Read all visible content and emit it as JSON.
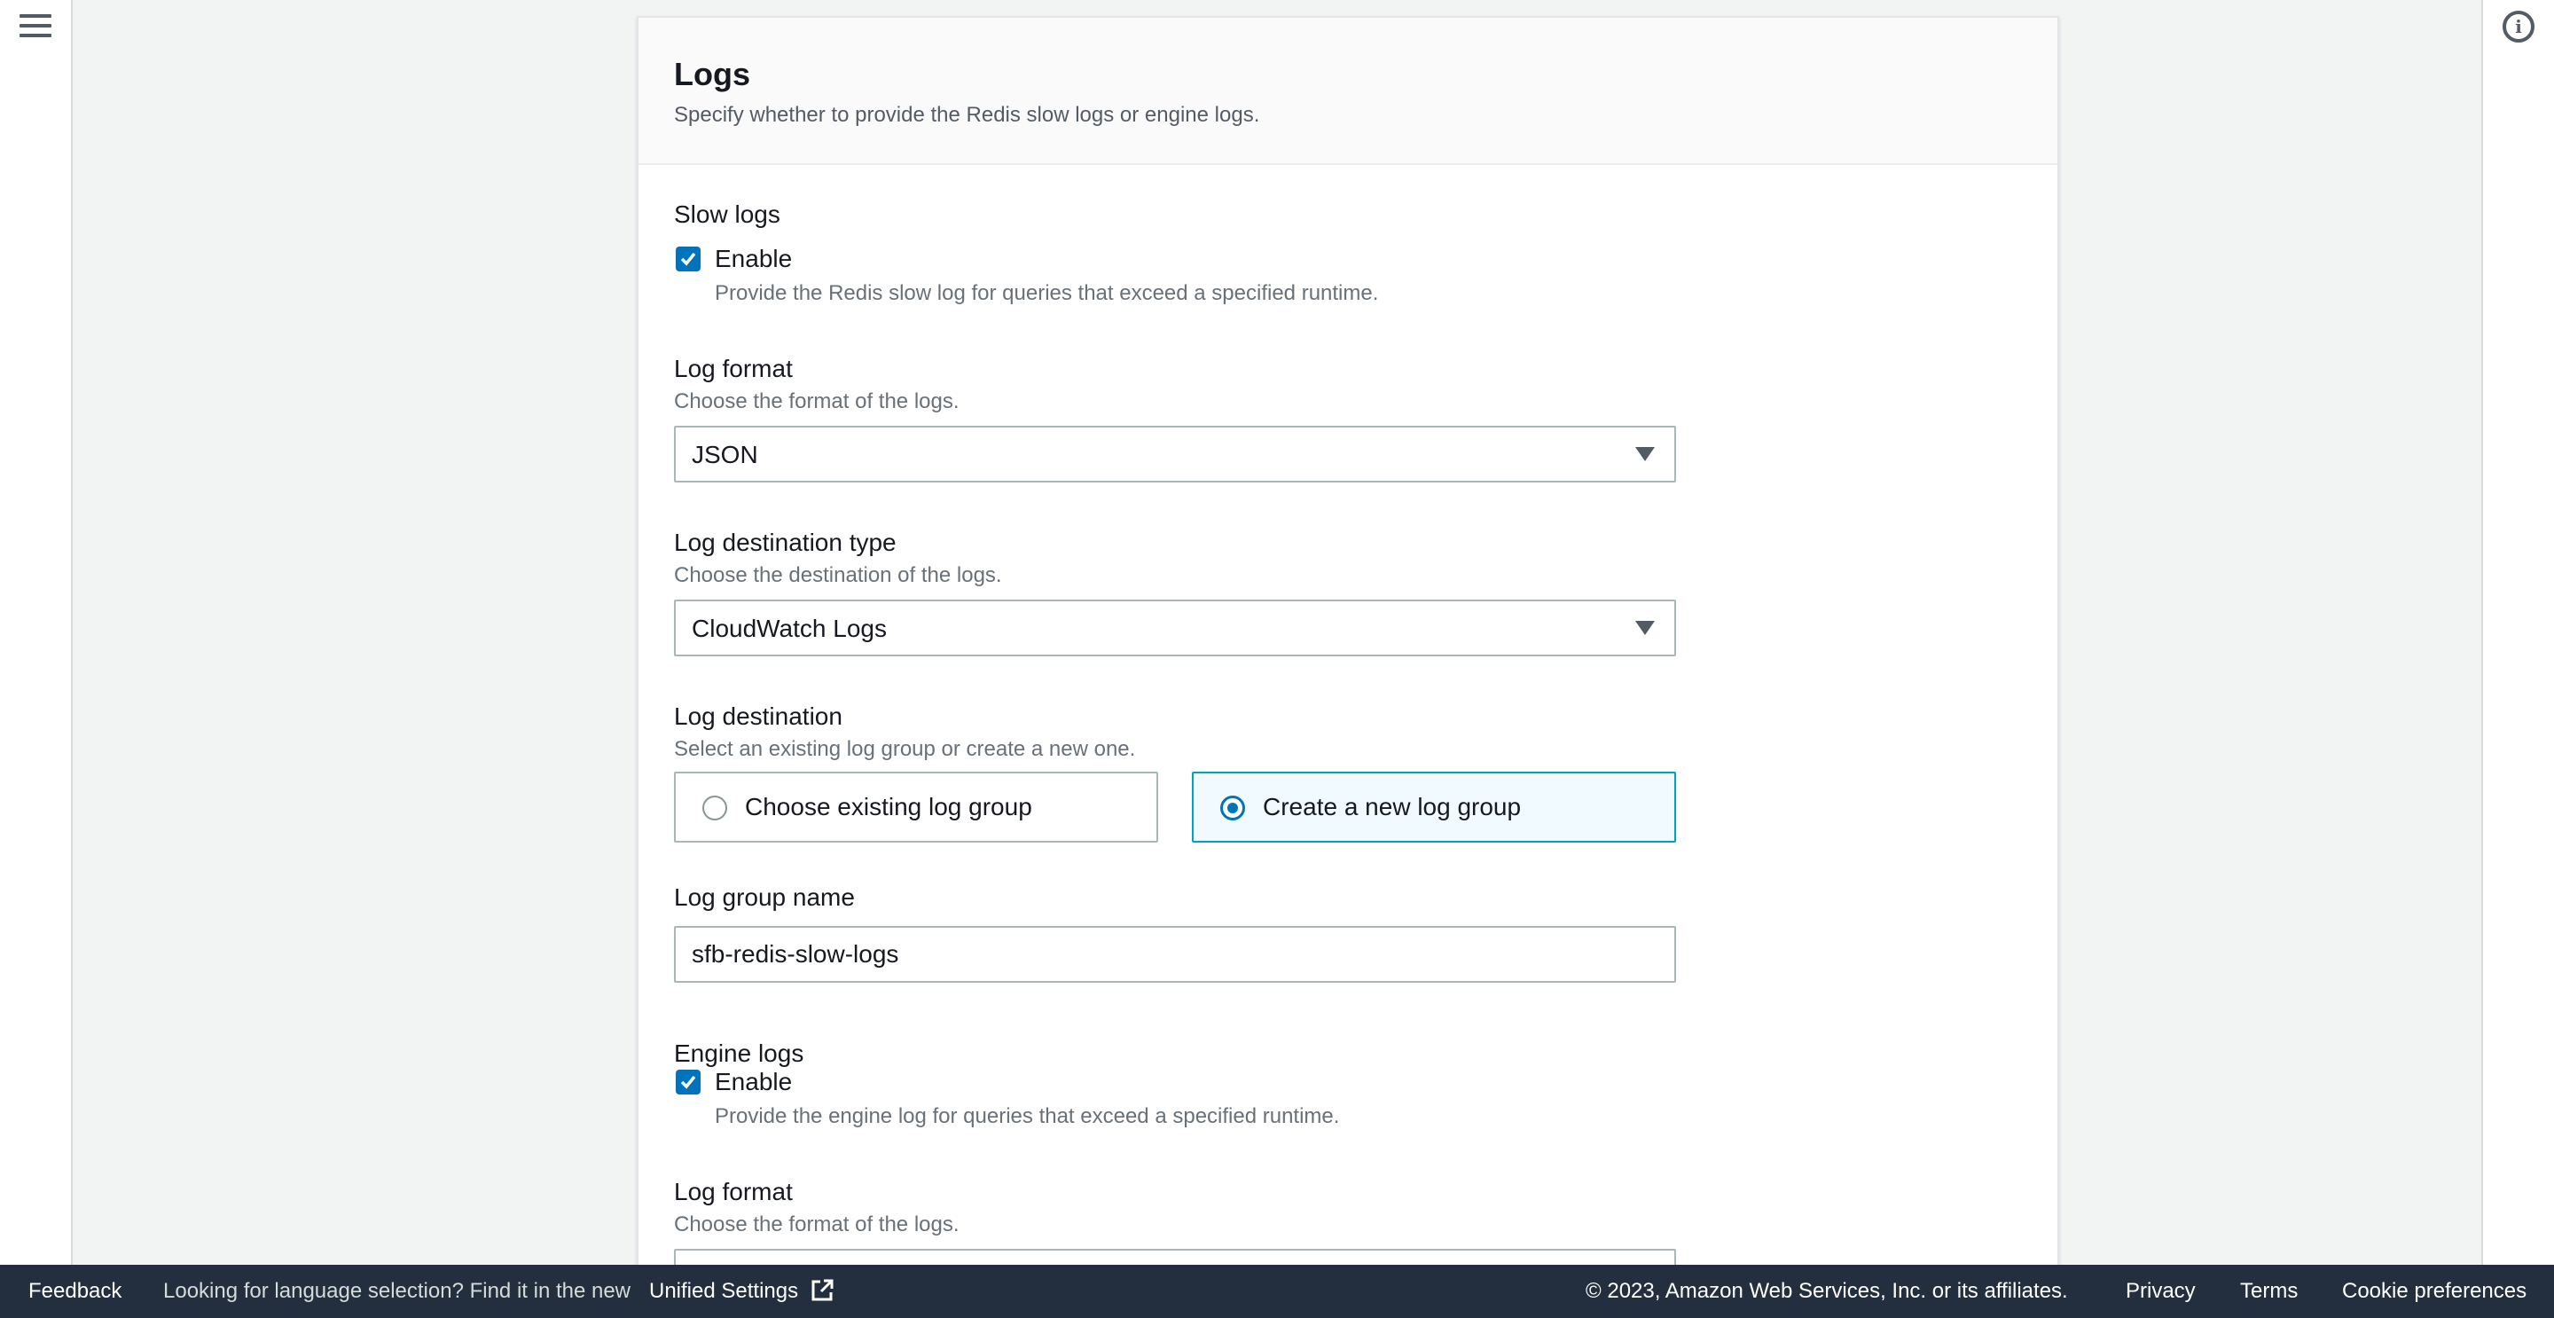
{
  "card": {
    "title": "Logs",
    "description": "Specify whether to provide the Redis slow logs or engine logs."
  },
  "slow_logs": {
    "label": "Slow logs",
    "enable_label": "Enable",
    "enabled": true,
    "description": "Provide the Redis slow log for queries that exceed a specified runtime.",
    "log_format": {
      "label": "Log format",
      "description": "Choose the format of the logs.",
      "value": "JSON"
    },
    "destination_type": {
      "label": "Log destination type",
      "description": "Choose the destination of the logs.",
      "value": "CloudWatch Logs"
    },
    "destination": {
      "label": "Log destination",
      "description": "Select an existing log group or create a new one.",
      "options": [
        "Choose existing log group",
        "Create a new log group"
      ],
      "selected": "Create a new log group"
    },
    "log_group_name": {
      "label": "Log group name",
      "value": "sfb-redis-slow-logs"
    }
  },
  "engine_logs": {
    "label": "Engine logs",
    "enable_label": "Enable",
    "enabled": true,
    "description": "Provide the engine log for queries that exceed a specified runtime.",
    "log_format": {
      "label": "Log format",
      "description": "Choose the format of the logs."
    }
  },
  "footer": {
    "feedback": "Feedback",
    "language_notice": "Looking for language selection? Find it in the new",
    "unified_settings": "Unified Settings",
    "copyright": "© 2023, Amazon Web Services, Inc. or its affiliates.",
    "privacy": "Privacy",
    "terms": "Terms",
    "cookie_preferences": "Cookie preferences"
  },
  "icons": {
    "menu": "hamburger-menu-icon",
    "info": "info-icon",
    "checkbox": "checkmark-icon",
    "select": "caret-down-icon",
    "external": "external-link-icon"
  },
  "colors": {
    "accent": "#0073bb",
    "selected_tile_border": "#00a1c9",
    "selected_tile_bg": "#f1faff",
    "footer_bg": "#232f3e"
  }
}
